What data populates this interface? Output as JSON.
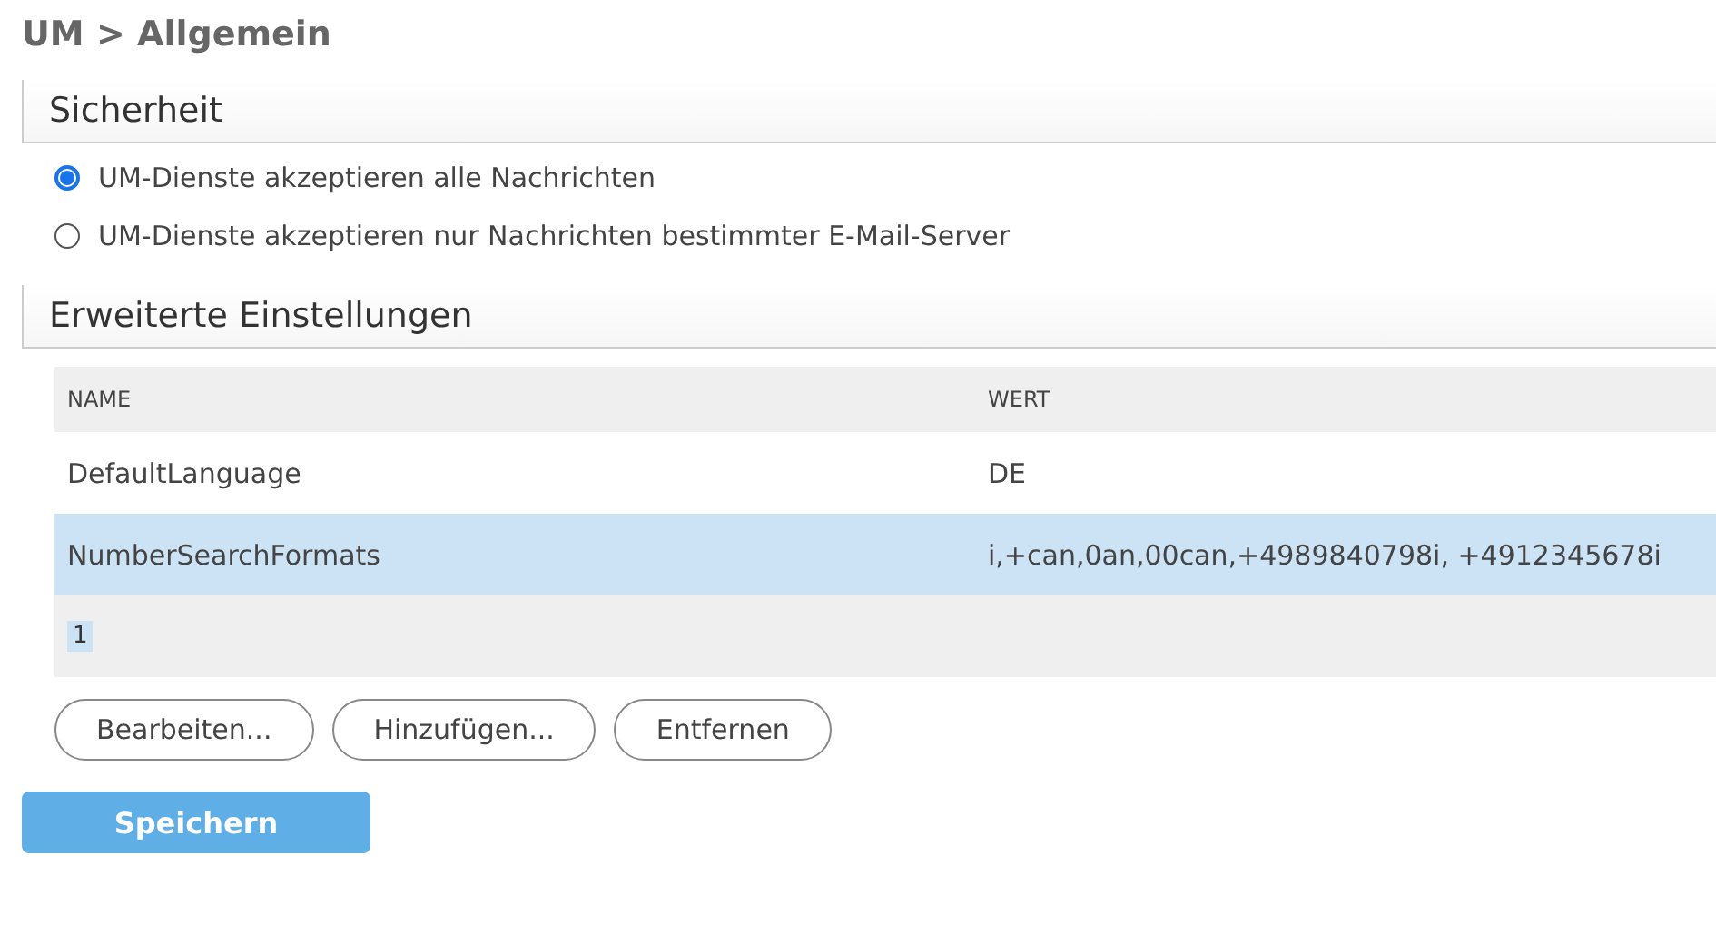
{
  "breadcrumb": "UM > Allgemein",
  "sections": [
    {
      "title": "Sicherheit"
    },
    {
      "title": "Erweiterte Einstellungen"
    }
  ],
  "security_options": [
    {
      "label": "UM-Dienste akzeptieren alle Nachrichten",
      "selected": true
    },
    {
      "label": "UM-Dienste akzeptieren nur Nachrichten bestimmter E-Mail-Server",
      "selected": false
    }
  ],
  "table": {
    "columns": [
      "NAME",
      "WERT"
    ],
    "rows": [
      {
        "cells": [
          "DefaultLanguage",
          "DE"
        ],
        "selected": false
      },
      {
        "cells": [
          "NumberSearchFormats",
          "i,+can,0an,00can,+4989840798i, +4912345678i"
        ],
        "selected": true
      }
    ],
    "pages": [
      {
        "label": "1",
        "selected": true
      }
    ]
  },
  "buttons": [
    "Bearbeiten...",
    "Hinzufügen...",
    "Entfernen"
  ],
  "save_button": "Speichern"
}
